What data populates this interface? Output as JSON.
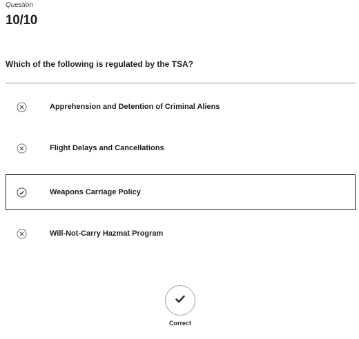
{
  "header": {
    "question_label": "Question",
    "question_count": "10/10"
  },
  "question": {
    "text": "Which of the following is regulated by the TSA?"
  },
  "answers": [
    {
      "label": "Apprehension and Detention of Criminal Aliens",
      "icon": "x-circle-icon",
      "selected": false
    },
    {
      "label": "Flight Delays and Cancellations",
      "icon": "x-circle-icon",
      "selected": false
    },
    {
      "label": "Weapons Carriage Policy",
      "icon": "check-circle-icon",
      "selected": true
    },
    {
      "label": "Will-Not-Carry Hazmat Program",
      "icon": "x-circle-icon",
      "selected": false
    }
  ],
  "result": {
    "icon": "checkmark-icon",
    "label": "Correct"
  },
  "colors": {
    "text": "#1c1d1f",
    "divider": "#8a8b8c",
    "icon_stroke": "#6a6f73"
  }
}
